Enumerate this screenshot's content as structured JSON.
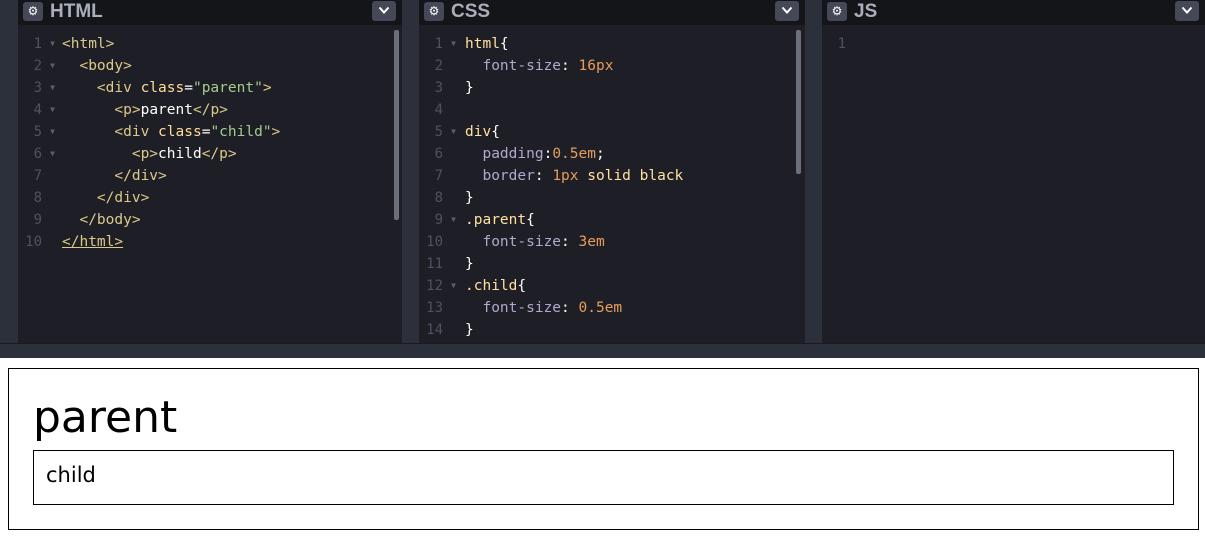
{
  "panes": {
    "html": {
      "title": "HTML",
      "line_numbers": [
        "1",
        "2",
        "3",
        "4",
        "5",
        "6",
        "7",
        "8",
        "9",
        "10"
      ],
      "lines": [
        [
          {
            "t": "<html>",
            "c": "tag"
          }
        ],
        [
          {
            "t": "  "
          },
          {
            "t": "<body>",
            "c": "tag"
          }
        ],
        [
          {
            "t": "    "
          },
          {
            "t": "<div ",
            "c": "tag"
          },
          {
            "t": "class",
            "c": "attr"
          },
          {
            "t": "=",
            "c": "text"
          },
          {
            "t": "\"parent\"",
            "c": "str"
          },
          {
            "t": ">",
            "c": "tag"
          }
        ],
        [
          {
            "t": "      "
          },
          {
            "t": "<p>",
            "c": "tag"
          },
          {
            "t": "parent",
            "c": "text"
          },
          {
            "t": "</p>",
            "c": "tag"
          }
        ],
        [
          {
            "t": "      "
          },
          {
            "t": "<div ",
            "c": "tag"
          },
          {
            "t": "class",
            "c": "attr"
          },
          {
            "t": "=",
            "c": "text"
          },
          {
            "t": "\"child\"",
            "c": "str"
          },
          {
            "t": ">",
            "c": "tag"
          }
        ],
        [
          {
            "t": "        "
          },
          {
            "t": "<p>",
            "c": "tag"
          },
          {
            "t": "child",
            "c": "text"
          },
          {
            "t": "</p>",
            "c": "tag"
          }
        ],
        [
          {
            "t": "      "
          },
          {
            "t": "</div>",
            "c": "tag"
          }
        ],
        [
          {
            "t": "    "
          },
          {
            "t": "</div>",
            "c": "tag"
          }
        ],
        [
          {
            "t": "  "
          },
          {
            "t": "</body>",
            "c": "tag"
          }
        ],
        [
          {
            "t": "</html>",
            "c": "tag ul"
          }
        ]
      ]
    },
    "css": {
      "title": "CSS",
      "line_numbers": [
        "1",
        "2",
        "3",
        "4",
        "5",
        "6",
        "7",
        "8",
        "9",
        "10",
        "11",
        "12",
        "13",
        "14"
      ],
      "lines": [
        [
          {
            "t": "html",
            "c": "sel"
          },
          {
            "t": "{",
            "c": "text"
          }
        ],
        [
          {
            "t": "  "
          },
          {
            "t": "font-size",
            "c": "prop"
          },
          {
            "t": ": ",
            "c": "text"
          },
          {
            "t": "16px",
            "c": "num"
          }
        ],
        [
          {
            "t": "}",
            "c": "text"
          }
        ],
        [],
        [
          {
            "t": "div",
            "c": "sel"
          },
          {
            "t": "{",
            "c": "text"
          }
        ],
        [
          {
            "t": "  "
          },
          {
            "t": "padding",
            "c": "prop"
          },
          {
            "t": ":",
            "c": "text"
          },
          {
            "t": "0.5em",
            "c": "num"
          },
          {
            "t": ";",
            "c": "text"
          }
        ],
        [
          {
            "t": "  "
          },
          {
            "t": "border",
            "c": "prop"
          },
          {
            "t": ": ",
            "c": "text"
          },
          {
            "t": "1px",
            "c": "num"
          },
          {
            "t": " solid black",
            "c": "kw"
          }
        ],
        [
          {
            "t": "}",
            "c": "text"
          }
        ],
        [
          {
            "t": ".parent",
            "c": "sel"
          },
          {
            "t": "{",
            "c": "text"
          }
        ],
        [
          {
            "t": "  "
          },
          {
            "t": "font-size",
            "c": "prop"
          },
          {
            "t": ": ",
            "c": "text"
          },
          {
            "t": "3em",
            "c": "num"
          }
        ],
        [
          {
            "t": "}",
            "c": "text"
          }
        ],
        [
          {
            "t": ".child",
            "c": "sel"
          },
          {
            "t": "{",
            "c": "text"
          }
        ],
        [
          {
            "t": "  "
          },
          {
            "t": "font-size",
            "c": "prop"
          },
          {
            "t": ": ",
            "c": "text"
          },
          {
            "t": "0.5em",
            "c": "num"
          }
        ],
        [
          {
            "t": "}",
            "c": "text"
          }
        ]
      ]
    },
    "js": {
      "title": "JS",
      "line_numbers": [
        "1"
      ],
      "lines": [
        []
      ]
    }
  },
  "icons": {
    "settings": "⚙",
    "collapse": "chevron-down-icon"
  },
  "preview": {
    "parent_text": "parent",
    "child_text": "child"
  },
  "colors": {
    "editor_bg": "#1e1f26",
    "header_bg": "#141518",
    "chrome_bg": "#2c303a",
    "tag": "#dcc98a",
    "attr": "#ffdd99",
    "string": "#a3cc8f",
    "property": "#b2a7cf",
    "number": "#e79c5a"
  }
}
